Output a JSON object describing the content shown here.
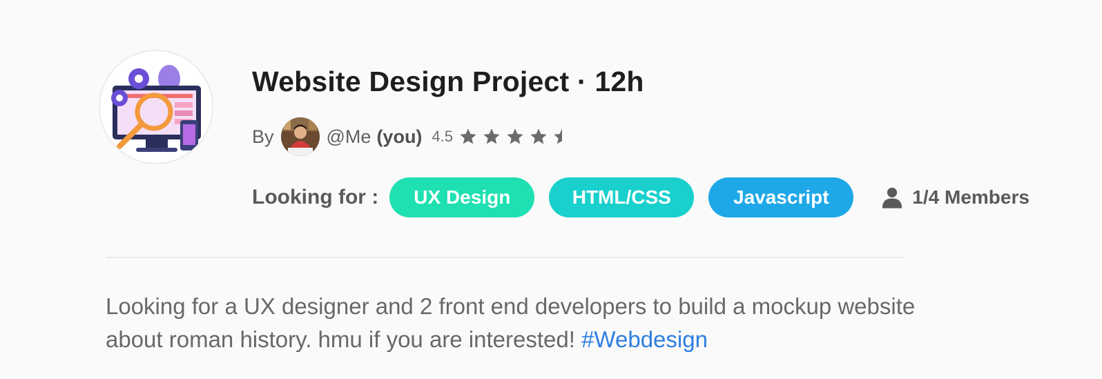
{
  "post": {
    "title": "Website Design Project · 12h",
    "author": {
      "by_label": "By",
      "handle": "@Me",
      "you_label": "(you)",
      "rating": "4.5",
      "stars": 4.5
    },
    "looking_for": {
      "label": "Looking for :",
      "tags": [
        {
          "label": "UX Design",
          "color": "#1ee0b1"
        },
        {
          "label": "HTML/CSS",
          "color": "#19d0cd"
        },
        {
          "label": "Javascript",
          "color": "#1ea8e8"
        }
      ]
    },
    "members": {
      "icon": "person-icon",
      "text": "1/4 Members"
    },
    "description": {
      "text": "Looking for a UX designer and 2 front end developers to build a mockup website about roman history. hmu if you are interested! ",
      "hashtag": "#Webdesign"
    }
  },
  "colors": {
    "title": "#1e1e1e",
    "muted_text": "#606060",
    "star": "#6b6b6b",
    "hashtag": "#2d7ee0",
    "divider": "#eaeaea",
    "background": "#fafafa"
  }
}
